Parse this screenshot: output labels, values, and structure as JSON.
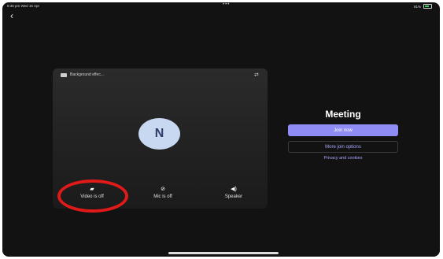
{
  "status_bar": {
    "time": "8:36 pm  Wed 16 Apr",
    "center": "•••",
    "battery": "81%"
  },
  "preview": {
    "background_effects_label": "Background effec...",
    "avatar_initial": "N",
    "controls": {
      "video_label": "Video is off",
      "mic_label": "Mic is off",
      "speaker_label": "Speaker"
    }
  },
  "meeting_panel": {
    "title": "Meeting",
    "join_now_label": "Join now",
    "more_options_label": "More join options",
    "privacy_link": "Privacy and cookies"
  },
  "icons": {
    "back": "chevron-left-icon",
    "background_effects": "sparkle-icon",
    "switch_camera": "camera-switch-icon",
    "video_off": "video-off-icon",
    "mic_off": "mic-off-icon",
    "speaker": "speaker-icon"
  },
  "colors": {
    "accent": "#8f8df5",
    "highlight_circle": "#e01919"
  }
}
